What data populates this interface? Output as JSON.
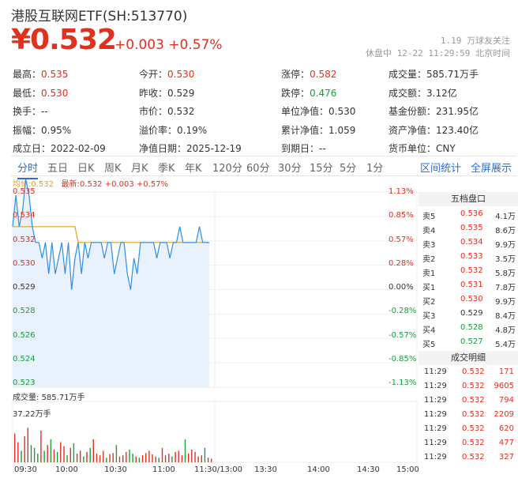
{
  "header": {
    "title": "港股互联网ETF(SH:513770)",
    "price": "¥0.532",
    "change": "+0.003 +0.57%",
    "watchers": "1.19 万球友关注",
    "status": "休盘中 12-22 11:29:59 北京时间"
  },
  "stats": [
    [
      {
        "l": "最高：",
        "v": "0.535",
        "c": "red"
      },
      {
        "l": "今开：",
        "v": "0.530",
        "c": "red"
      },
      {
        "l": "涨停：",
        "v": "0.582",
        "c": "red"
      },
      {
        "l": "成交量：",
        "v": "585.71万手",
        "c": ""
      }
    ],
    [
      {
        "l": "最低：",
        "v": "0.530",
        "c": "red"
      },
      {
        "l": "昨收：",
        "v": "0.529",
        "c": ""
      },
      {
        "l": "跌停：",
        "v": "0.476",
        "c": "green"
      },
      {
        "l": "成交额：",
        "v": "3.12亿",
        "c": ""
      }
    ],
    [
      {
        "l": "换手：",
        "v": "--",
        "c": ""
      },
      {
        "l": "市价：",
        "v": "0.532",
        "c": ""
      },
      {
        "l": "单位净值：",
        "v": "0.530",
        "c": ""
      },
      {
        "l": "基金份额：",
        "v": "231.95亿",
        "c": ""
      }
    ],
    [
      {
        "l": "振幅：",
        "v": "0.95%",
        "c": ""
      },
      {
        "l": "溢价率：",
        "v": "0.19%",
        "c": ""
      },
      {
        "l": "累计净值：",
        "v": "1.059",
        "c": ""
      },
      {
        "l": "资产净值：",
        "v": "123.40亿",
        "c": ""
      }
    ],
    [
      {
        "l": "成立日：",
        "v": "2022-02-09",
        "c": ""
      },
      {
        "l": "净值日期：",
        "v": "2025-12-19",
        "c": ""
      },
      {
        "l": "到期日：",
        "v": "--",
        "c": ""
      },
      {
        "l": "货币单位：",
        "v": "CNY",
        "c": ""
      }
    ]
  ],
  "tabs": [
    "分时",
    "五日",
    "日K",
    "周K",
    "月K",
    "季K",
    "年K",
    "120分",
    "60分",
    "30分",
    "15分",
    "5分",
    "1分"
  ],
  "tabs_right": [
    "区间统计",
    "全屏展示"
  ],
  "legend": {
    "avg": "均价:0.532",
    "latest": "最新:0.532 +0.003 +0.57%"
  },
  "y_left": [
    {
      "v": "0.535",
      "c": "red"
    },
    {
      "v": "0.534",
      "c": "red"
    },
    {
      "v": "0.532",
      "c": "red"
    },
    {
      "v": "0.530",
      "c": "red"
    },
    {
      "v": "0.529",
      "c": ""
    },
    {
      "v": "0.528",
      "c": "green"
    },
    {
      "v": "0.526",
      "c": "green"
    },
    {
      "v": "0.524",
      "c": "green"
    },
    {
      "v": "0.523",
      "c": "green"
    }
  ],
  "y_right": [
    {
      "v": "1.13%",
      "c": "red"
    },
    {
      "v": "0.85%",
      "c": "red"
    },
    {
      "v": "0.57%",
      "c": "red"
    },
    {
      "v": "0.28%",
      "c": "red"
    },
    {
      "v": "0.00%",
      "c": ""
    },
    {
      "v": "-0.28%",
      "c": "green"
    },
    {
      "v": "-0.57%",
      "c": "green"
    },
    {
      "v": "-0.85%",
      "c": "green"
    },
    {
      "v": "-1.13%",
      "c": "green"
    }
  ],
  "orderbook": {
    "title": "五档盘口",
    "rows": [
      {
        "l": "卖5",
        "p": "0.536",
        "q": "4.1万",
        "c": "red"
      },
      {
        "l": "卖4",
        "p": "0.535",
        "q": "8.6万",
        "c": "red"
      },
      {
        "l": "卖3",
        "p": "0.534",
        "q": "9.9万",
        "c": "red"
      },
      {
        "l": "卖2",
        "p": "0.533",
        "q": "3.5万",
        "c": "red"
      },
      {
        "l": "卖1",
        "p": "0.532",
        "q": "5.8万",
        "c": "red"
      },
      {
        "l": "买1",
        "p": "0.531",
        "q": "7.8万",
        "c": "red"
      },
      {
        "l": "买2",
        "p": "0.530",
        "q": "9.9万",
        "c": "red"
      },
      {
        "l": "买3",
        "p": "0.529",
        "q": "8.4万",
        "c": ""
      },
      {
        "l": "买4",
        "p": "0.528",
        "q": "4.8万",
        "c": "green"
      },
      {
        "l": "买5",
        "p": "0.527",
        "q": "5.4万",
        "c": "green"
      }
    ]
  },
  "details": {
    "title": "成交明细",
    "rows": [
      {
        "t": "11:29",
        "p": "0.532",
        "v": "171"
      },
      {
        "t": "11:29",
        "p": "0.532",
        "v": "9605"
      },
      {
        "t": "11:29",
        "p": "0.532",
        "v": "794"
      },
      {
        "t": "11:29",
        "p": "0.532",
        "v": "2209"
      },
      {
        "t": "11:29",
        "p": "0.532",
        "v": "620"
      },
      {
        "t": "11:29",
        "p": "0.532",
        "v": "477"
      },
      {
        "t": "11:29",
        "p": "0.532",
        "v": "327"
      }
    ]
  },
  "volume": {
    "label": "成交量: 585.71万手",
    "max": "37.22万手"
  },
  "x_labels": [
    "09:30",
    "10:00",
    "10:30",
    "11:00",
    "11:30/13:00",
    "13:30",
    "14:00",
    "14:30",
    "15:00"
  ],
  "colors": {
    "price": "#2d8fe6",
    "avg": "#e8a11a",
    "up": "#e0301e",
    "down": "#1a9c3a",
    "accent": "#2d6fd6"
  },
  "chart_data": {
    "type": "line",
    "ylim": [
      0.523,
      0.535
    ],
    "prev_close": 0.529,
    "price": [
      0.533,
      0.535,
      0.533,
      0.534,
      0.536,
      0.535,
      0.533,
      0.532,
      0.532,
      0.531,
      0.532,
      0.53,
      0.532,
      0.53,
      0.531,
      0.532,
      0.53,
      0.532,
      0.529,
      0.531,
      0.532,
      0.53,
      0.532,
      0.531,
      0.532,
      0.532,
      0.532,
      0.532,
      0.531,
      0.532,
      0.532,
      0.53,
      0.531,
      0.532,
      0.532,
      0.53,
      0.529,
      0.531,
      0.53,
      0.532,
      0.532,
      0.532,
      0.532,
      0.532,
      0.531,
      0.532,
      0.532,
      0.532,
      0.531,
      0.532,
      0.532,
      0.533,
      0.532,
      0.532,
      0.532,
      0.532,
      0.532,
      0.533,
      0.532,
      0.532,
      0.532
    ],
    "avg": [
      0.533,
      0.533,
      0.533,
      0.533,
      0.533,
      0.533,
      0.533,
      0.533,
      0.533,
      0.533,
      0.533,
      0.533,
      0.533,
      0.533,
      0.533,
      0.533,
      0.533,
      0.533,
      0.533,
      0.533,
      0.532,
      0.532,
      0.532,
      0.532,
      0.532,
      0.532,
      0.532,
      0.532,
      0.532,
      0.532,
      0.532,
      0.532,
      0.532,
      0.532,
      0.532,
      0.532,
      0.532,
      0.532,
      0.532,
      0.532,
      0.532,
      0.532,
      0.532,
      0.532,
      0.532,
      0.532,
      0.532,
      0.532,
      0.532,
      0.532,
      0.532,
      0.532,
      0.532,
      0.532,
      0.532,
      0.532,
      0.532,
      0.532,
      0.532,
      0.532,
      0.532
    ],
    "volume": [
      0.5,
      0.35,
      0.2,
      0.45,
      0.6,
      0.3,
      0.25,
      0.15,
      0.55,
      0.2,
      0.3,
      0.4,
      0.22,
      0.18,
      0.35,
      0.28,
      0.12,
      0.25,
      0.33,
      0.15,
      0.2,
      0.1,
      0.18,
      0.25,
      0.4,
      0.15,
      0.12,
      0.2,
      0.08,
      0.14,
      0.16,
      0.3,
      0.1,
      0.12,
      0.18,
      0.22,
      0.15,
      0.1,
      0.08,
      0.12,
      0.16,
      0.2,
      0.14,
      0.1,
      0.08,
      0.25,
      0.12,
      0.15,
      0.1,
      0.18,
      0.2,
      0.12,
      0.4,
      0.15,
      0.22,
      0.18,
      0.1,
      0.12,
      0.25,
      0.08,
      0.06
    ],
    "volume_max": 1.0
  }
}
